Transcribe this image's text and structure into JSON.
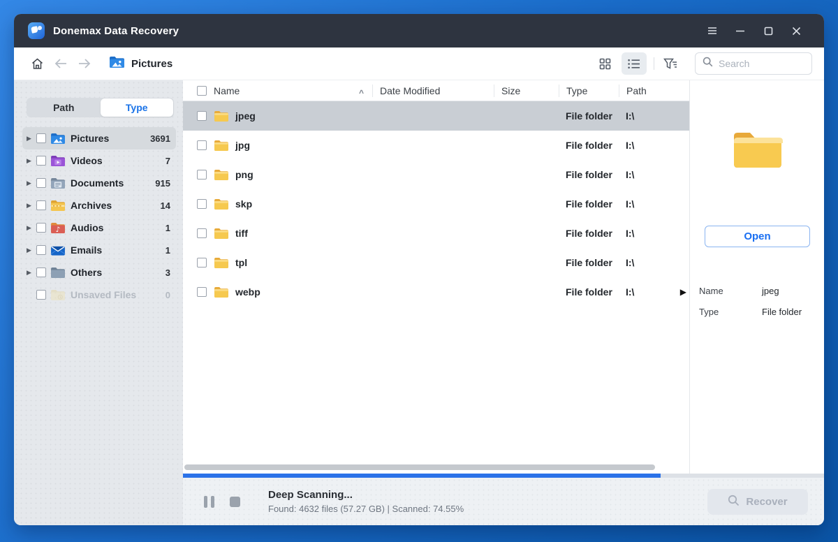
{
  "window": {
    "title": "Donemax Data Recovery",
    "controls": {
      "menu": "menu",
      "minimize": "minimize",
      "maximize": "maximize",
      "close": "close"
    }
  },
  "toolbar": {
    "breadcrumb": "Pictures",
    "search_placeholder": "Search",
    "icons": [
      "home-icon",
      "back-arrow-icon",
      "forward-arrow-icon",
      "grid-view-icon",
      "list-view-icon",
      "filter-icon",
      "search-icon"
    ]
  },
  "sidebar": {
    "tabs": [
      {
        "label": "Path",
        "active": false
      },
      {
        "label": "Type",
        "active": true
      }
    ],
    "items": [
      {
        "label": "Pictures",
        "count": "3691",
        "icon": "pictures-folder-icon",
        "selected": true,
        "disabled": false
      },
      {
        "label": "Videos",
        "count": "7",
        "icon": "videos-folder-icon",
        "selected": false,
        "disabled": false
      },
      {
        "label": "Documents",
        "count": "915",
        "icon": "documents-folder-icon",
        "selected": false,
        "disabled": false
      },
      {
        "label": "Archives",
        "count": "14",
        "icon": "archives-folder-icon",
        "selected": false,
        "disabled": false
      },
      {
        "label": "Audios",
        "count": "1",
        "icon": "audios-folder-icon",
        "selected": false,
        "disabled": false
      },
      {
        "label": "Emails",
        "count": "1",
        "icon": "emails-envelope-icon",
        "selected": false,
        "disabled": false
      },
      {
        "label": "Others",
        "count": "3",
        "icon": "others-folder-icon",
        "selected": false,
        "disabled": false
      },
      {
        "label": "Unsaved Files",
        "count": "0",
        "icon": "unsaved-folder-icon",
        "selected": false,
        "disabled": true
      }
    ]
  },
  "filelist": {
    "columns": {
      "name": "Name",
      "date": "Date Modified",
      "size": "Size",
      "type": "Type",
      "path": "Path"
    },
    "sort_indicator": "^",
    "rows": [
      {
        "name": "jpeg",
        "date": "",
        "size": "",
        "type": "File folder",
        "path": "I:\\",
        "selected": true
      },
      {
        "name": "jpg",
        "date": "",
        "size": "",
        "type": "File folder",
        "path": "I:\\",
        "selected": false
      },
      {
        "name": "png",
        "date": "",
        "size": "",
        "type": "File folder",
        "path": "I:\\",
        "selected": false
      },
      {
        "name": "skp",
        "date": "",
        "size": "",
        "type": "File folder",
        "path": "I:\\",
        "selected": false
      },
      {
        "name": "tiff",
        "date": "",
        "size": "",
        "type": "File folder",
        "path": "I:\\",
        "selected": false
      },
      {
        "name": "tpl",
        "date": "",
        "size": "",
        "type": "File folder",
        "path": "I:\\",
        "selected": false
      },
      {
        "name": "webp",
        "date": "",
        "size": "",
        "type": "File folder",
        "path": "I:\\",
        "selected": false
      }
    ]
  },
  "preview": {
    "icon": "large-folder-icon",
    "open_label": "Open",
    "fields": [
      {
        "label": "Name",
        "value": "jpeg"
      },
      {
        "label": "Type",
        "value": "File folder"
      }
    ]
  },
  "status": {
    "title": "Deep Scanning...",
    "detail": "Found: 4632 files (57.27 GB) | Scanned: 74.55%",
    "progress_percent": 74.55,
    "recover_label": "Recover",
    "icons": [
      "pause-icon",
      "stop-icon",
      "recover-search-icon"
    ]
  },
  "colors": {
    "accent_blue": "#1a73e8",
    "progress_blue": "#2b72e8",
    "titlebar_dark": "#2e3440",
    "selected_row_gray": "#c9ced4",
    "folder_yellow": "#f6c94f"
  }
}
